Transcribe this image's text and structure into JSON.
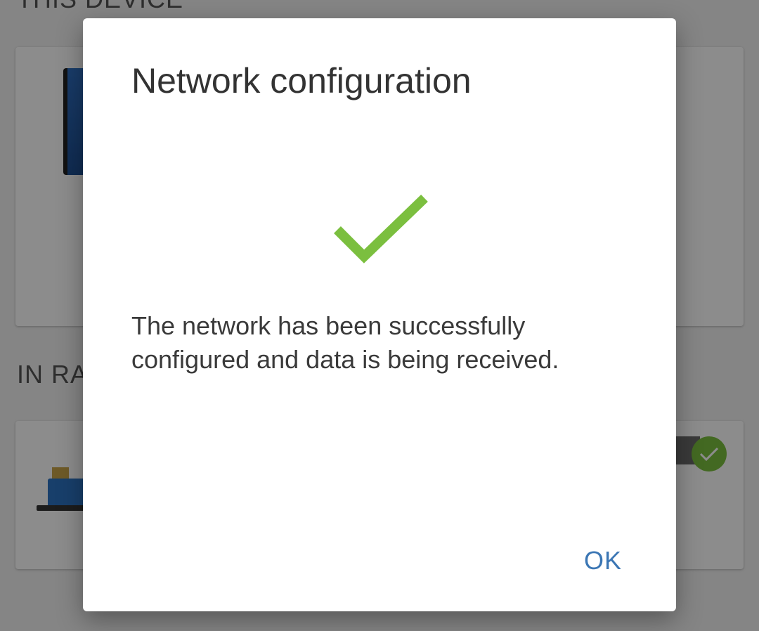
{
  "background": {
    "section_this_device": "THIS DEVICE",
    "section_in_range": "IN RA"
  },
  "dialog": {
    "title": "Network configuration",
    "message": "The network has been successfully configured and data is being received.",
    "ok_label": "OK",
    "success_icon": "checkmark-icon"
  },
  "colors": {
    "accent": "#3b76b4",
    "success": "#7bbf3f",
    "title_text": "#333333"
  }
}
